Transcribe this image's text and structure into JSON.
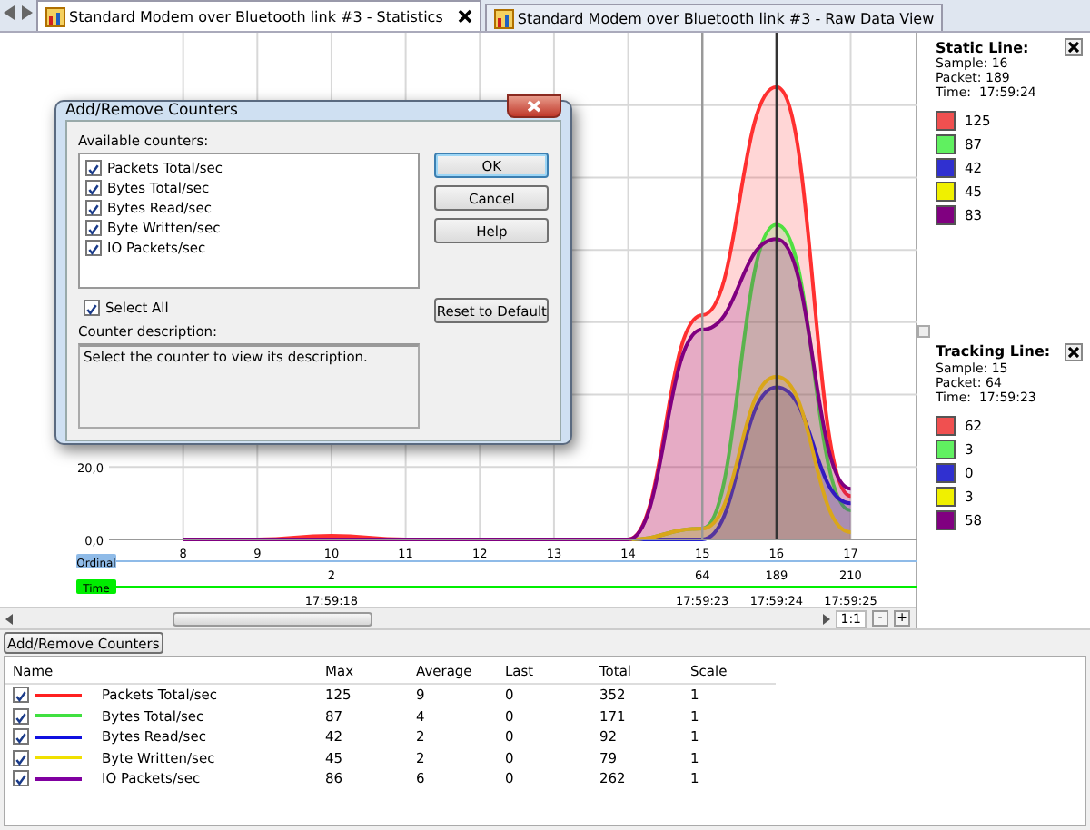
{
  "tabs": [
    {
      "label": "Standard Modem over Bluetooth link #3 - Statistics",
      "selected": true
    },
    {
      "label": "Standard Modem over Bluetooth link #3 - Raw Data View",
      "selected": false
    }
  ],
  "chart": {
    "chart_data": {
      "type": "area",
      "x": [
        8,
        9,
        10,
        11,
        12,
        13,
        14,
        15,
        16,
        17
      ],
      "series": [
        {
          "color": "#ff3030",
          "values": [
            0,
            0,
            1,
            0,
            0,
            0,
            0,
            62,
            125,
            12
          ]
        },
        {
          "color": "#50e040",
          "values": [
            0,
            0,
            0,
            0,
            0,
            0,
            0,
            3,
            87,
            8
          ]
        },
        {
          "color": "#2020d0",
          "values": [
            0,
            0,
            0,
            0,
            0,
            0,
            0,
            0,
            42,
            10
          ]
        },
        {
          "color": "#f0d000",
          "values": [
            0,
            0,
            0,
            0,
            0,
            0,
            0,
            3,
            45,
            2
          ]
        },
        {
          "color": "#800080",
          "values": [
            0,
            0,
            0,
            0,
            0,
            0,
            0,
            58,
            83,
            14
          ]
        }
      ],
      "grid": true,
      "xlim": [
        7,
        17.9
      ],
      "ylim": [
        0,
        140
      ],
      "xticks": [
        8,
        9,
        10,
        11,
        12,
        13,
        14,
        15,
        16,
        17
      ],
      "yticks": [
        {
          "value": 0,
          "label": "0,0"
        },
        {
          "value": 20,
          "label": "20,0"
        }
      ],
      "ref_lines": [
        {
          "axis": "x",
          "value": 16,
          "color": "#333333"
        },
        {
          "axis": "x",
          "value": 15,
          "color": "#999999"
        }
      ]
    },
    "rows": [
      {
        "label": "Ordinal",
        "color": "#8fbbe8",
        "cells": [
          {},
          {},
          {
            "text": "2"
          },
          {},
          {},
          {},
          {},
          {
            "text": "64"
          },
          {
            "text": "189"
          },
          {
            "text": "210"
          }
        ]
      },
      {
        "label": "Time",
        "color": "#00ee00",
        "cells": [
          {},
          {},
          {
            "text": "17:59:18"
          },
          {},
          {},
          {},
          {},
          {
            "text": "17:59:23"
          },
          {
            "text": "17:59:24"
          },
          {
            "text": "17:59:25"
          }
        ]
      }
    ],
    "zoom": {
      "ratio": "1:1",
      "zoom_out": "-",
      "zoom_in": "+"
    }
  },
  "dialog": {
    "title": "Add/Remove Counters",
    "available_label": "Available counters:",
    "counters": [
      {
        "label": "Packets Total/sec",
        "checked": true
      },
      {
        "label": "Bytes Total/sec",
        "checked": true
      },
      {
        "label": "Bytes Read/sec",
        "checked": true
      },
      {
        "label": "Byte Written/sec",
        "checked": true
      },
      {
        "label": "IO Packets/sec",
        "checked": true
      }
    ],
    "buttons": [
      "OK",
      "Cancel",
      "Help"
    ],
    "select_all": {
      "label": "Select All",
      "checked": true
    },
    "description_label": "Counter description:",
    "description": "Select the counter to view its description.",
    "reset_button": "Reset to Default"
  },
  "panels": [
    {
      "title": "Static Line:",
      "sample": "Sample: 16",
      "packet": "Packet: 189",
      "time": "Time:  17:59:24",
      "values": [
        {
          "color": "#f05050",
          "text": "125"
        },
        {
          "color": "#60f060",
          "text": "87"
        },
        {
          "color": "#3030d0",
          "text": "42"
        },
        {
          "color": "#f0f000",
          "text": "45"
        },
        {
          "color": "#800080",
          "text": "83"
        }
      ]
    },
    {
      "title": "Tracking Line:",
      "sample": "Sample: 15",
      "packet": "Packet: 64",
      "time": "Time:  17:59:23",
      "values": [
        {
          "color": "#f05050",
          "text": "62"
        },
        {
          "color": "#60f060",
          "text": "3"
        },
        {
          "color": "#3030d0",
          "text": "0"
        },
        {
          "color": "#f0f000",
          "text": "3"
        },
        {
          "color": "#800080",
          "text": "58"
        }
      ]
    }
  ],
  "add_remove_button": "Add/Remove Counters",
  "table": {
    "columns": [
      "Name",
      "Max",
      "Average",
      "Last",
      "Total",
      "Scale"
    ],
    "rows": [
      {
        "checked": true,
        "color": "#ff2020",
        "name": "Packets Total/sec",
        "max": "125",
        "average": "9",
        "last": "0",
        "total": "352",
        "scale": "1"
      },
      {
        "checked": true,
        "color": "#40e040",
        "name": "Bytes Total/sec",
        "max": "87",
        "average": "4",
        "last": "0",
        "total": "171",
        "scale": "1"
      },
      {
        "checked": true,
        "color": "#1010e0",
        "name": "Bytes Read/sec",
        "max": "42",
        "average": "2",
        "last": "0",
        "total": "92",
        "scale": "1"
      },
      {
        "checked": true,
        "color": "#f0e000",
        "name": "Byte Written/sec",
        "max": "45",
        "average": "2",
        "last": "0",
        "total": "79",
        "scale": "1"
      },
      {
        "checked": true,
        "color": "#8000a0",
        "name": "IO Packets/sec",
        "max": "86",
        "average": "6",
        "last": "0",
        "total": "262",
        "scale": "1"
      }
    ]
  }
}
